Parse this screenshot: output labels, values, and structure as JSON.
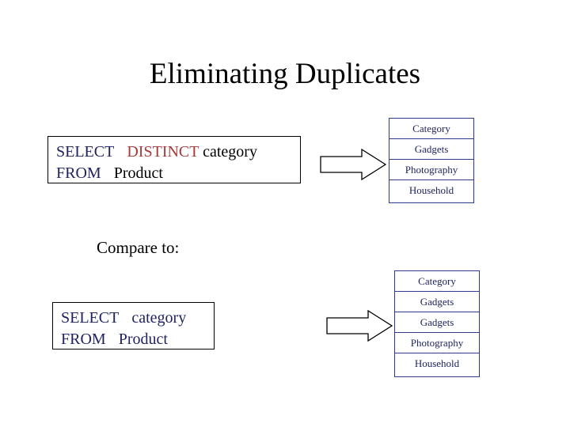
{
  "slide": {
    "title": "Eliminating Duplicates",
    "compare_label": "Compare to:",
    "queries": [
      {
        "name": "distinct-query",
        "line1_select": "SELECT",
        "line1_distinct": "DISTINCT",
        "line1_column": "category",
        "line2_from": "FROM",
        "line2_table": "Product"
      },
      {
        "name": "plain-query",
        "line1_select": "SELECT",
        "line1_distinct": "",
        "line1_column": "category",
        "line2_from": "FROM",
        "line2_table": "Product"
      }
    ],
    "results": [
      {
        "name": "distinct-result",
        "header": "Category",
        "rows": [
          "Gadgets",
          "Photography",
          "Household"
        ]
      },
      {
        "name": "plain-result",
        "header": "Category",
        "rows": [
          "Gadgets",
          "Gadgets",
          "Photography",
          "Household"
        ]
      }
    ],
    "arrows": [
      {
        "name": "arrow-distinct"
      },
      {
        "name": "arrow-plain"
      }
    ],
    "colors": {
      "sql_text": "#1f2460",
      "keyword_distinct": "#a63a3a",
      "table_border": "#2f3a8f",
      "title": "#000000"
    }
  }
}
